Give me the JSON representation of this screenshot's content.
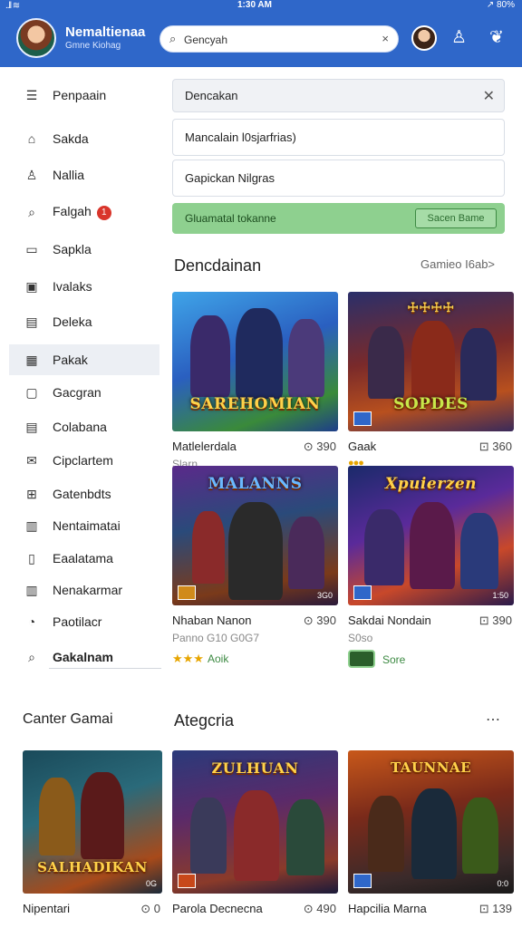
{
  "status": {
    "signal": "..ll ≋",
    "time": "1:30 AM",
    "battery": "↗ 80%"
  },
  "header": {
    "app_title": "Nemaltienaa",
    "app_subtitle": "Gmne Kiohag",
    "search": {
      "value": "Gencyah",
      "placeholder": "Search"
    }
  },
  "sidebar": {
    "items": [
      {
        "label": "Penpaain",
        "icon": "menu-icon"
      },
      {
        "label": "Sakda",
        "icon": "home-icon"
      },
      {
        "label": "Nallia",
        "icon": "person-icon"
      },
      {
        "label": "Falgah",
        "icon": "search-icon",
        "badge": "1"
      },
      {
        "label": "Sapkla",
        "icon": "chat-icon"
      },
      {
        "label": "Ivalaks",
        "icon": "calendar-icon"
      },
      {
        "label": "Deleka",
        "icon": "clipboard-icon"
      },
      {
        "label": "Pakak",
        "icon": "calendar-grid-icon"
      },
      {
        "label": "Gacgran",
        "icon": "square-icon"
      },
      {
        "label": "Colabana",
        "icon": "doc-icon"
      },
      {
        "label": "Cipclartem",
        "icon": "mail-icon"
      },
      {
        "label": "Gatenbdts",
        "icon": "grid-icon"
      },
      {
        "label": "Nentaimatai",
        "icon": "list-icon"
      },
      {
        "label": "Eaalatama",
        "icon": "phone-icon"
      },
      {
        "label": "Nenakarmar",
        "icon": "list-icon"
      },
      {
        "label": "Paotilacr",
        "icon": "gift-icon"
      },
      {
        "label": "Gakalnam",
        "icon": "pin-icon"
      }
    ]
  },
  "main": {
    "field1": "Dencakan",
    "field2": "Mancalain l0sjarfrias)",
    "field3": "Gapickan Nilgras",
    "green_text": "Gluamatal tokanne",
    "green_button": "Sacen Bame",
    "section1": {
      "title": "Dencdainan",
      "link": "Gamieo  I6ab>"
    },
    "cards1": [
      {
        "art": "SAREHOMIAN",
        "name": "Matlelerdala",
        "price": "⊙ 390",
        "sub": "Slarn"
      },
      {
        "art": "SOPDES",
        "name": "Gaak",
        "price": "⊡ 360",
        "dots": "●●●"
      },
      {
        "art": "MALANNS",
        "name": "Nhaban Nanon",
        "price": "⊙ 390",
        "sub": "Panno G10 G0G7",
        "stars": "★★★",
        "rating": "Aoik"
      },
      {
        "art": "Xpuierzen",
        "name": "Sakdai Nondain",
        "price": "⊡ 390",
        "sub": "S0so",
        "rating": "Sore"
      }
    ],
    "section2_left": "Canter Gamai",
    "section2": {
      "title": "Ategcria",
      "more": "⋯"
    },
    "cards2": [
      {
        "art": "SALHADIKAN",
        "name": "Nipentari",
        "price": "⊙ 0"
      },
      {
        "art": "ZULHUAN",
        "name": "Parola Decnecna",
        "price": "⊙ 490"
      },
      {
        "art": "TAUNNAE",
        "name": "Hapcilia Marna",
        "price": "⊡ 139"
      }
    ]
  },
  "colors": {
    "brand_blue": "#2f67c9",
    "success_green": "#8ed08f",
    "badge_red": "#d9352b",
    "star_gold": "#e7a500"
  }
}
